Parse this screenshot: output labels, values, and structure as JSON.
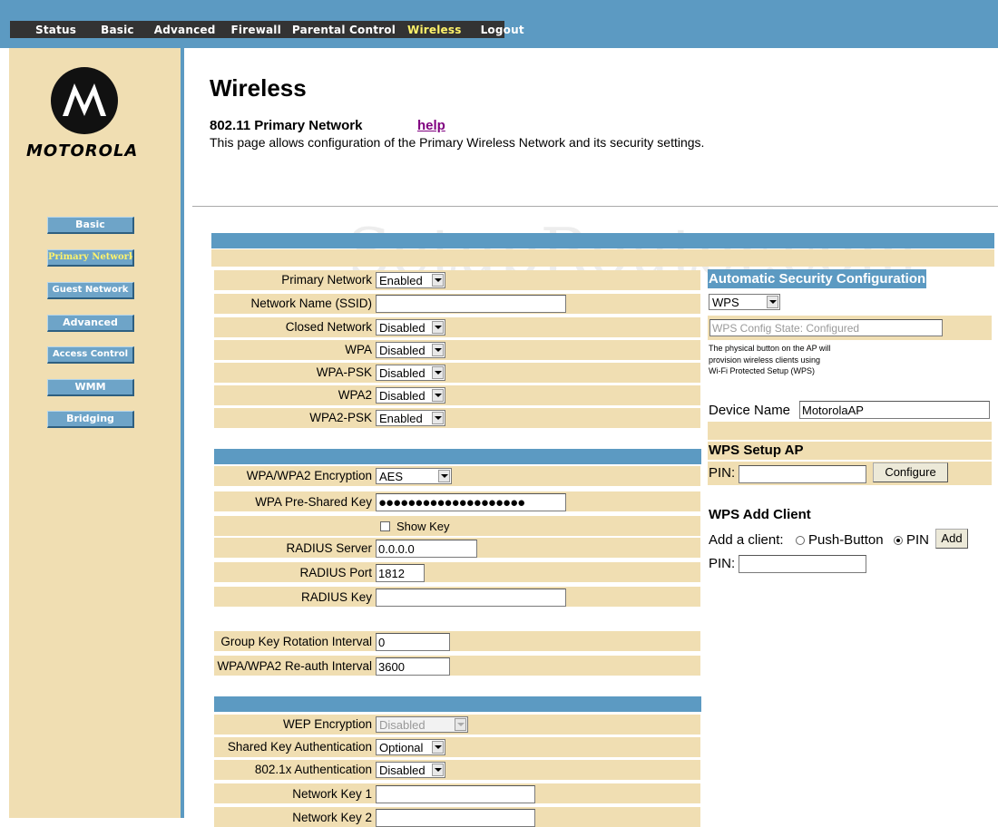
{
  "topnav": {
    "items": [
      {
        "label": "Status",
        "active": false
      },
      {
        "label": "Basic",
        "active": false
      },
      {
        "label": "Advanced",
        "active": false
      },
      {
        "label": "Firewall",
        "active": false
      },
      {
        "label": "Parental Control",
        "active": false
      },
      {
        "label": "Wireless",
        "active": true
      },
      {
        "label": "Logout",
        "active": false
      }
    ]
  },
  "brand": {
    "name": "MOTOROLA"
  },
  "sidebar": {
    "items": [
      {
        "label": "Basic",
        "active": false
      },
      {
        "label": "Primary Network",
        "active": true
      },
      {
        "label": "Guest Network",
        "active": false
      },
      {
        "label": "Advanced",
        "active": false
      },
      {
        "label": "Access Control",
        "active": false
      },
      {
        "label": "WMM",
        "active": false
      },
      {
        "label": "Bridging",
        "active": false
      }
    ]
  },
  "page": {
    "title": "Wireless",
    "subtitle": "802.11 Primary Network",
    "help": "help",
    "description": "This page allows configuration of the Primary Wireless Network and its security settings."
  },
  "watermark": "SetupRouter.com",
  "primary": {
    "primary_network": {
      "label": "Primary Network",
      "value": "Enabled"
    },
    "ssid": {
      "label": "Network Name (SSID)",
      "value": ""
    },
    "closed_network": {
      "label": "Closed Network",
      "value": "Disabled"
    },
    "wpa": {
      "label": "WPA",
      "value": "Disabled"
    },
    "wpa_psk": {
      "label": "WPA-PSK",
      "value": "Disabled"
    },
    "wpa2": {
      "label": "WPA2",
      "value": "Disabled"
    },
    "wpa2_psk": {
      "label": "WPA2-PSK",
      "value": "Enabled"
    }
  },
  "security": {
    "encryption": {
      "label": "WPA/WPA2 Encryption",
      "value": "AES"
    },
    "psk": {
      "label": "WPA Pre-Shared Key",
      "value": "●●●●●●●●●●●●●●●●●●●●"
    },
    "show_key": {
      "label": "Show Key"
    },
    "radius_server": {
      "label": "RADIUS Server",
      "value": "0.0.0.0"
    },
    "radius_port": {
      "label": "RADIUS Port",
      "value": "1812"
    },
    "radius_key": {
      "label": "RADIUS Key",
      "value": ""
    }
  },
  "intervals": {
    "group_key": {
      "label": "Group Key Rotation Interval",
      "value": "0"
    },
    "reauth": {
      "label": "WPA/WPA2 Re-auth Interval",
      "value": "3600"
    }
  },
  "wep": {
    "encryption": {
      "label": "WEP Encryption",
      "value": "Disabled"
    },
    "shared_key_auth": {
      "label": "Shared Key Authentication",
      "value": "Optional"
    },
    "dot1x_auth": {
      "label": "802.1x Authentication",
      "value": "Disabled"
    },
    "key1": {
      "label": "Network Key 1",
      "value": ""
    },
    "key2": {
      "label": "Network Key 2",
      "value": ""
    }
  },
  "auto": {
    "title": "Automatic Security Configuration",
    "mode": "WPS",
    "state": "WPS Config State: Configured",
    "note": [
      "The physical button on the AP will",
      "provision wireless clients using",
      "Wi-Fi Protected Setup (WPS)"
    ],
    "device_name_label": "Device Name",
    "device_name": "MotorolaAP",
    "setup_title": "WPS Setup AP",
    "pin_label": "PIN:",
    "setup_pin": "",
    "configure": "Configure",
    "add_title": "WPS Add Client",
    "add_label": "Add a client:",
    "push_button": "Push-Button",
    "pin_option": "PIN",
    "add": "Add",
    "client_pin": ""
  },
  "colors": {
    "accent": "#5c9ac2",
    "panel": "#f0deb2",
    "nav": "#333333",
    "nav_active": "#fff36b",
    "link": "#800080"
  }
}
